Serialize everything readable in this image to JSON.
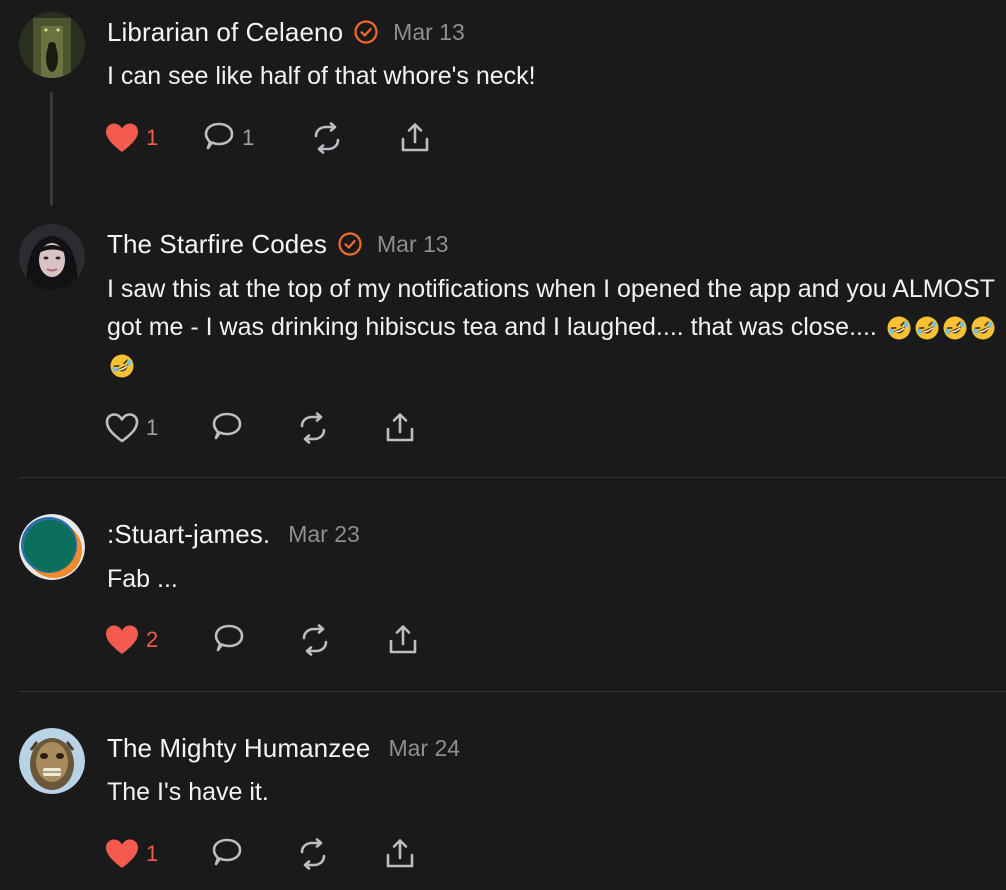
{
  "colors": {
    "background": "#1a1a1b",
    "accent_verified": "#f26b2b",
    "like_active": "#f25b4d",
    "muted_text": "#8e8e93"
  },
  "comments": [
    {
      "name": "Librarian of Celaeno",
      "verified": true,
      "date": "Mar 13",
      "text": "I can see like half of that whore's neck!",
      "likes": "1",
      "liked": true,
      "replies": "1",
      "avatar_icon": "dark-corridor-figure-avatar"
    },
    {
      "name": "The Starfire Codes",
      "verified": true,
      "date": "Mar 13",
      "text": "I saw this at the top of my notifications when I opened the app and you ALMOST got me - I was drinking hibiscus tea and I laughed.... that was close....",
      "emoji_count": 5,
      "emoji_icon": "rolling-on-floor-laughing-emoji",
      "likes": "1",
      "liked": false,
      "replies": "",
      "avatar_icon": "woman-portrait-avatar"
    },
    {
      "name": ":Stuart-james.",
      "verified": false,
      "date": "Mar 23",
      "text": "Fab ...",
      "likes": "2",
      "liked": true,
      "replies": "",
      "avatar_icon": "teal-orange-circle-avatar"
    },
    {
      "name": "The Mighty Humanzee",
      "verified": false,
      "date": "Mar 24",
      "text": "The I's have it.",
      "likes": "1",
      "liked": true,
      "replies": "",
      "avatar_icon": "ape-face-avatar"
    }
  ]
}
